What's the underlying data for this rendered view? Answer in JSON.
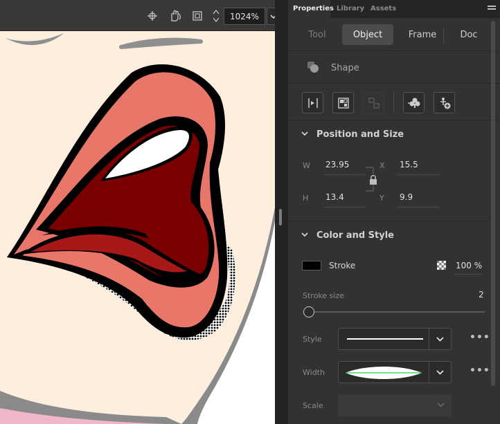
{
  "toolbar": {
    "zoom_value": "1024%",
    "icons": [
      "snap-icon",
      "hand-rotate-icon",
      "clip-icon"
    ]
  },
  "panel": {
    "tabs": [
      {
        "label": "Properties",
        "active": true
      },
      {
        "label": "Library",
        "active": false
      },
      {
        "label": "Assets",
        "active": false
      }
    ],
    "mode_tabs": [
      {
        "label": "Tool",
        "active": false
      },
      {
        "label": "Object",
        "active": true
      },
      {
        "label": "Frame",
        "active": false
      },
      {
        "label": "Doc",
        "active": false
      }
    ],
    "object_type": "Shape",
    "position_size": {
      "title": "Position and Size",
      "w_label": "W",
      "w_value": "23.95",
      "h_label": "H",
      "h_value": "13.4",
      "x_label": "X",
      "x_value": "15.5",
      "y_label": "Y",
      "y_value": "9.9"
    },
    "color_style": {
      "title": "Color and Style",
      "stroke_label": "Stroke",
      "stroke_color": "#000000",
      "stroke_alpha": "100 %",
      "stroke_size_label": "Stroke size",
      "stroke_size_value": "2",
      "stroke_size_fraction": 0.0,
      "style_label": "Style",
      "width_label": "Width",
      "scale_label": "Scale",
      "more_label": "•••"
    }
  },
  "colors": {
    "panel_bg": "#323232",
    "lip_outer": "#e8776a",
    "mouth_dark": "#7a0000",
    "lip_inner": "#a81818",
    "skin": "#fdeedd",
    "outline_gray": "#8a8a8a"
  }
}
